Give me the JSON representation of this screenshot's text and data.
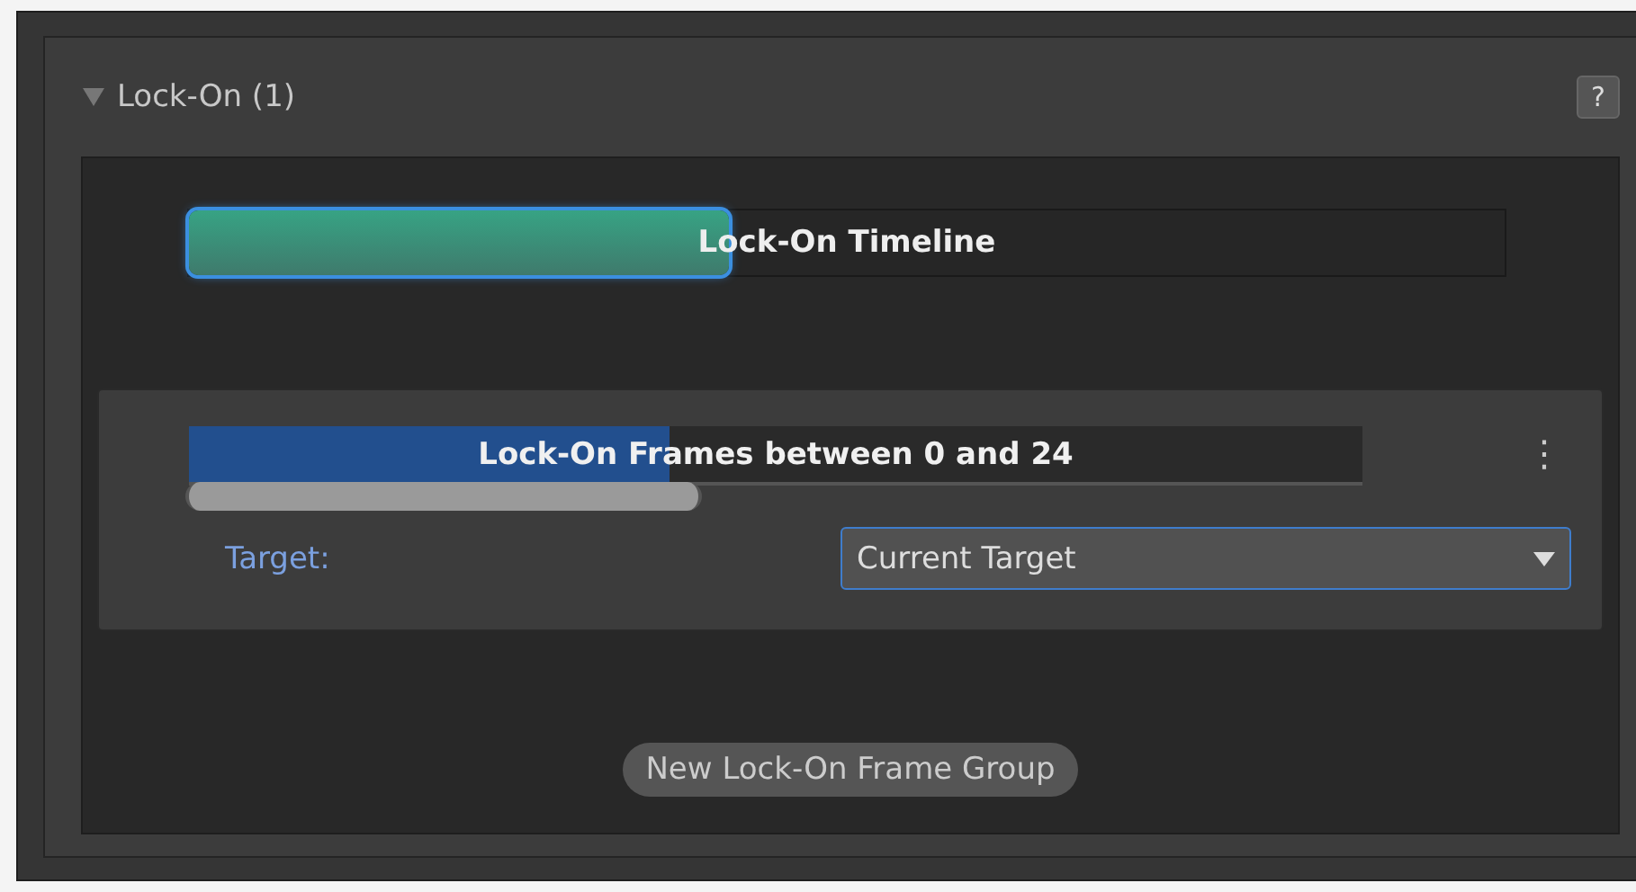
{
  "section": {
    "title": "Lock-On (1)",
    "expanded": true,
    "help": "?"
  },
  "timeline": {
    "label": "Lock-On Timeline",
    "level": 0.41,
    "focused": true
  },
  "frame_groups": [
    {
      "label": "Lock-On Frames between 0 and 24",
      "level": 0.41,
      "range": {
        "level": 0.44
      },
      "menu": "⋮",
      "target_label": "Target:",
      "target_value": "Current Target"
    }
  ],
  "add_button": "New Lock-On Frame Group"
}
